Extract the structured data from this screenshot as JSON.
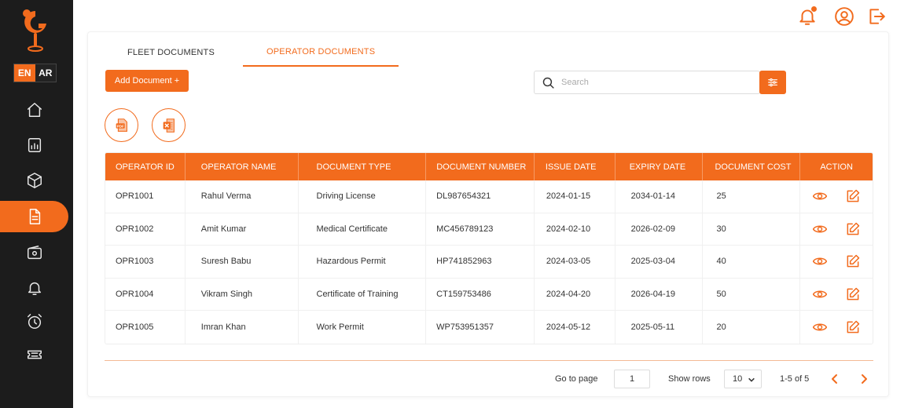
{
  "sidebar": {
    "lang_en": "EN",
    "lang_ar": "AR",
    "items": [
      {
        "icon": "home-icon"
      },
      {
        "icon": "reports-icon"
      },
      {
        "icon": "package-icon"
      },
      {
        "icon": "documents-icon",
        "active": true
      },
      {
        "icon": "payment-icon"
      },
      {
        "icon": "bell-icon"
      },
      {
        "icon": "alarm-clock-icon"
      },
      {
        "icon": "ticket-icon"
      }
    ]
  },
  "header": {
    "icons": [
      "notification-bell-icon",
      "user-profile-icon",
      "logout-icon"
    ]
  },
  "tabs": [
    {
      "label": "FLEET DOCUMENTS",
      "active": false
    },
    {
      "label": "OPERATOR DOCUMENTS",
      "active": true
    }
  ],
  "toolbar": {
    "add_label": "Add Document +",
    "search_placeholder": "Search"
  },
  "table": {
    "columns": [
      "OPERATOR ID",
      "OPERATOR NAME",
      "DOCUMENT TYPE",
      "DOCUMENT NUMBER",
      "ISSUE DATE",
      "EXPIRY DATE",
      "DOCUMENT COST",
      "ACTION"
    ],
    "rows": [
      [
        "OPR1001",
        "Rahul Verma",
        "Driving License",
        "DL987654321",
        "2024-01-15",
        "2034-01-14",
        "25"
      ],
      [
        "OPR1002",
        "Amit Kumar",
        "Medical Certificate",
        "MC456789123",
        "2024-02-10",
        "2026-02-09",
        "30"
      ],
      [
        "OPR1003",
        "Suresh Babu",
        "Hazardous Permit",
        "HP741852963",
        "2024-03-05",
        "2025-03-04",
        "40"
      ],
      [
        "OPR1004",
        "Vikram Singh",
        "Certificate of Training",
        "CT159753486",
        "2024-04-20",
        "2026-04-19",
        "50"
      ],
      [
        "OPR1005",
        "Imran Khan",
        "Work Permit",
        "WP753951357",
        "2024-05-12",
        "2025-05-11",
        "20"
      ]
    ]
  },
  "pagination": {
    "go_to_label": "Go to page",
    "page_value": "1",
    "show_rows_label": "Show rows",
    "rows_value": "10",
    "range_text": "1-5 of 5"
  },
  "colors": {
    "accent": "#f26b1d",
    "sidebar": "#1c1c1c"
  }
}
